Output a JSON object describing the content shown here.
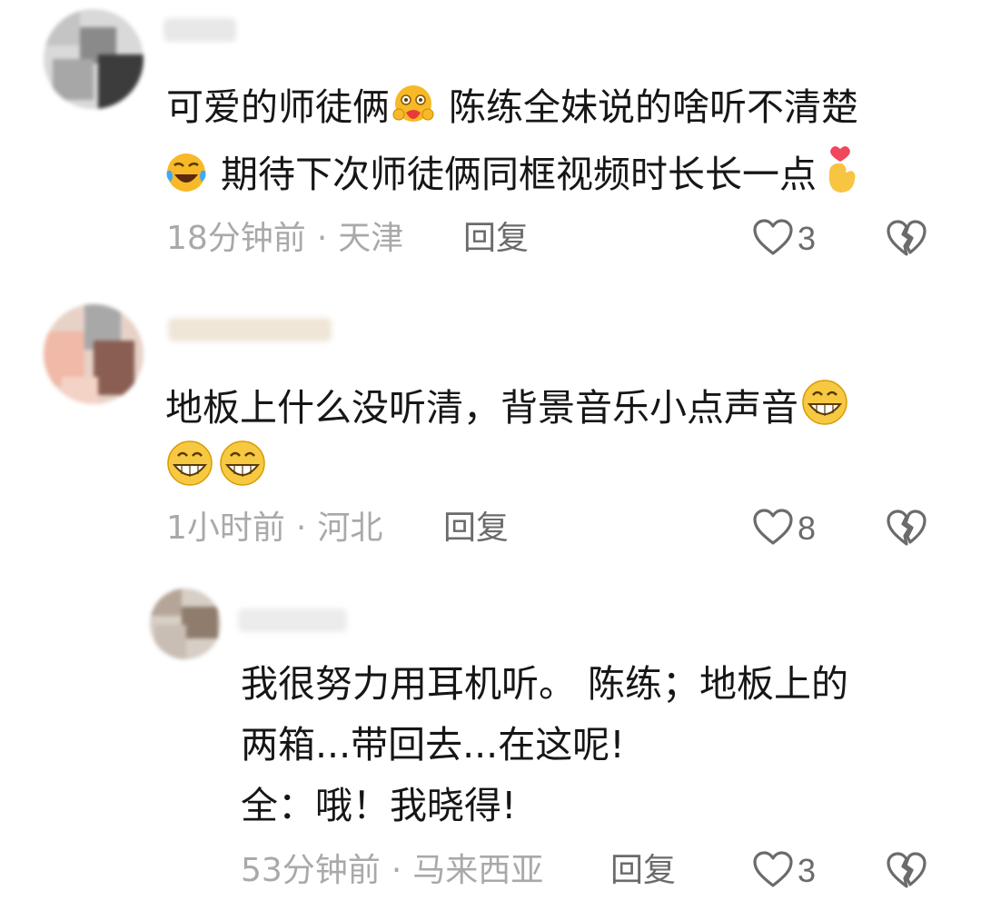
{
  "comments": [
    {
      "lines": [
        {
          "before": "可爱的师徒俩",
          "emoji": "smiling-hug-face",
          "after": " 陈练全妹说的啥听不清楚"
        },
        {
          "before_emoji": "laughing-tears-face",
          "text": " 期待下次师徒俩同框视频时长长一点",
          "after_emoji": "finger-heart"
        }
      ],
      "time": "18分钟前",
      "location": "天津",
      "reply_label": "回复",
      "likes": "3"
    },
    {
      "lines": [
        {
          "text": "地板上什么没听清，背景音乐小点声音",
          "after_emoji": "grinning-face"
        },
        {
          "emojis": [
            "grinning-face",
            "grinning-face"
          ]
        }
      ],
      "time": "1小时前",
      "location": "河北",
      "reply_label": "回复",
      "likes": "8"
    }
  ],
  "reply": {
    "lines": [
      "我很努力用耳机听。 陈练；地板上的",
      "两箱...带回去...在这呢!",
      "全：哦！我晓得!"
    ],
    "time": "53分钟前",
    "location": "马来西亚",
    "reply_label": "回复",
    "likes": "3"
  },
  "colors": {
    "text": "#161616",
    "meta": "#a9a9a9",
    "action": "#6b6b6b"
  }
}
